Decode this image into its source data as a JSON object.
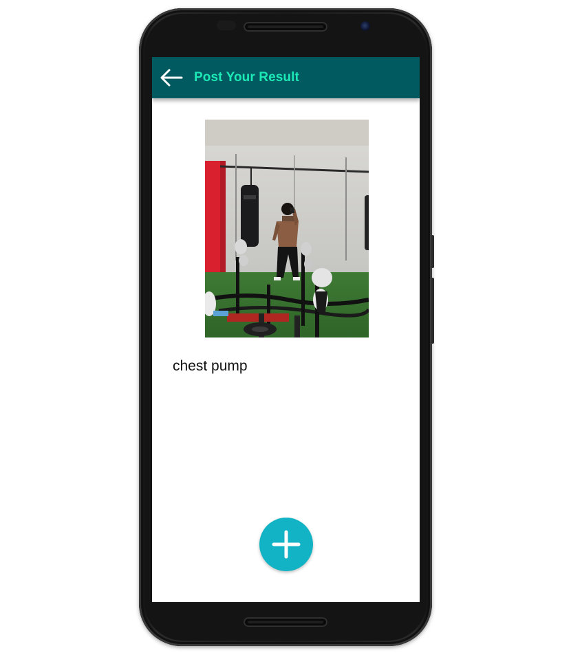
{
  "app": {
    "title": "Post Your Result"
  },
  "post": {
    "caption": "chest pump"
  },
  "icons": {
    "back": "arrow-back-icon",
    "add": "plus-icon"
  },
  "colors": {
    "appbar": "#005a60",
    "title": "#1de9b6",
    "fab": "#12b3c4"
  }
}
